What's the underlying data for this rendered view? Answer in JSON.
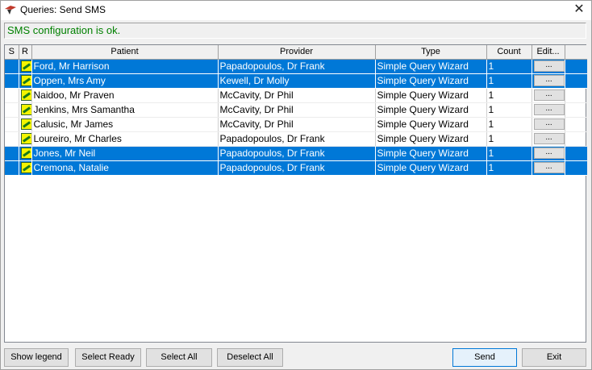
{
  "window": {
    "title": "Queries: Send SMS",
    "close_glyph": "✕"
  },
  "status": "SMS configuration is ok.",
  "table": {
    "columns": [
      "S",
      "R",
      "Patient",
      "Provider",
      "Type",
      "Count",
      "Edit..."
    ],
    "rows": [
      {
        "selected": true,
        "patient": "Ford, Mr Harrison",
        "provider": "Papadopoulos, Dr Frank",
        "type": "Simple Query Wizard",
        "count": "1"
      },
      {
        "selected": true,
        "patient": "Oppen, Mrs Amy",
        "provider": "Kewell, Dr Molly",
        "type": "Simple Query Wizard",
        "count": "1"
      },
      {
        "selected": false,
        "patient": "Naidoo, Mr Praven",
        "provider": "McCavity, Dr Phil",
        "type": "Simple Query Wizard",
        "count": "1"
      },
      {
        "selected": false,
        "patient": "Jenkins, Mrs Samantha",
        "provider": "McCavity, Dr Phil",
        "type": "Simple Query Wizard",
        "count": "1"
      },
      {
        "selected": false,
        "patient": "Calusic, Mr James",
        "provider": "McCavity, Dr Phil",
        "type": "Simple Query Wizard",
        "count": "1"
      },
      {
        "selected": false,
        "patient": "Loureiro, Mr Charles",
        "provider": "Papadopoulos, Dr Frank",
        "type": "Simple Query Wizard",
        "count": "1"
      },
      {
        "selected": true,
        "patient": "Jones, Mr Neil",
        "provider": "Papadopoulos, Dr Frank",
        "type": "Simple Query Wizard",
        "count": "1"
      },
      {
        "selected": true,
        "patient": "Cremona,  Natalie",
        "provider": "Papadopoulos, Dr Frank",
        "type": "Simple Query Wizard",
        "count": "1"
      }
    ],
    "edit_label": "..."
  },
  "buttons": {
    "show_legend": "Show legend",
    "select_ready": "Select Ready",
    "select_all": "Select All",
    "deselect_all": "Deselect All",
    "send": "Send",
    "exit": "Exit"
  },
  "colors": {
    "selection": "#0078d7",
    "status_text": "#008000",
    "ready_icon": "#f4f400"
  }
}
